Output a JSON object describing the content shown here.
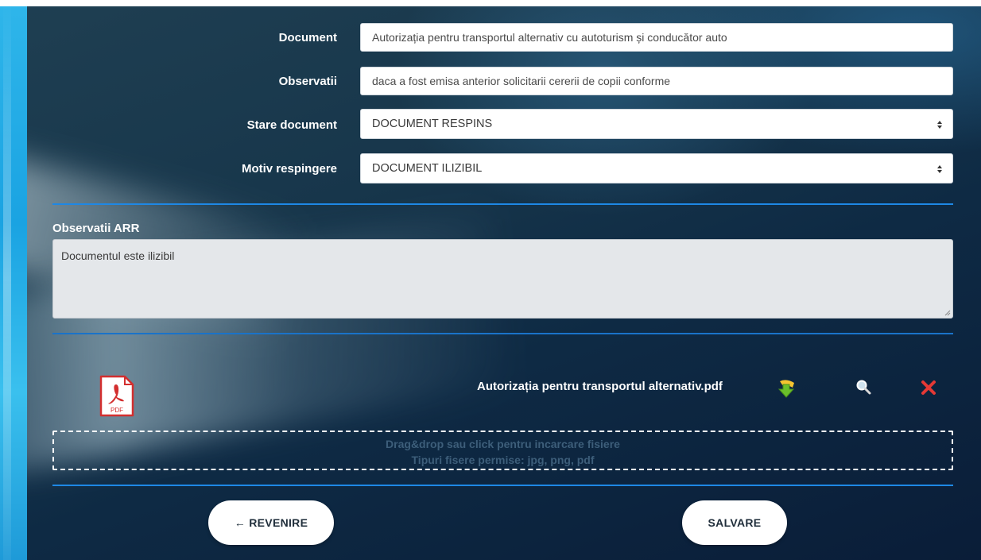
{
  "form": {
    "document": {
      "label": "Document",
      "value": "Autorizația pentru transportul alternativ cu autoturism și conducător auto"
    },
    "observatii": {
      "label": "Observatii",
      "value": "daca a fost emisa anterior solicitarii cererii de copii conforme"
    },
    "stare_document": {
      "label": "Stare document",
      "value": "DOCUMENT RESPINS"
    },
    "motiv_respingere": {
      "label": "Motiv respingere",
      "value": "DOCUMENT ILIZIBIL"
    }
  },
  "observatii_arr": {
    "label": "Observatii ARR",
    "value": "Documentul este ilizibil"
  },
  "attachment": {
    "icon": "pdf-file-icon",
    "icon_text": "PDF",
    "filename": "Autorizația pentru transportul alternativ.pdf",
    "actions": [
      "download-icon",
      "search-icon",
      "delete-icon"
    ]
  },
  "dropzone": {
    "line1": "Drag&drop sau click pentru incarcare fisiere",
    "line2": "Tipuri fisere permise: jpg, png, pdf"
  },
  "buttons": {
    "back": "← REVENIRE",
    "save": "SALVARE"
  },
  "colors": {
    "accent_line": "#1e88e5",
    "download_green": "#6abf2a",
    "delete_red": "#e53935",
    "sidebar_blue": "#1aa3e2"
  }
}
